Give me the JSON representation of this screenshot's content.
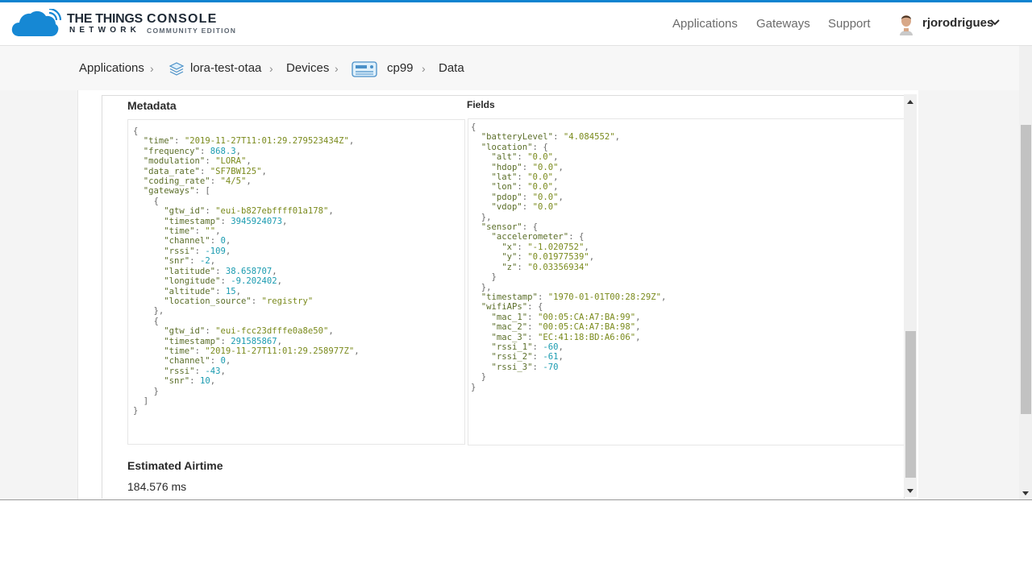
{
  "header": {
    "brand_line1": "THE THINGS",
    "brand_line2": "NETWORK",
    "console_line1": "CONSOLE",
    "console_line2": "COMMUNITY EDITION",
    "nav": [
      "Applications",
      "Gateways",
      "Support"
    ],
    "username": "rjorodrigues",
    "brand_color": "#1688d4"
  },
  "breadcrumb": {
    "items": [
      "Applications",
      "lora-test-otaa",
      "Devices",
      "cp99",
      "Data"
    ]
  },
  "metadata": {
    "title": "Metadata",
    "json": "{\n  \"time\": \"2019-11-27T11:01:29.279523434Z\",\n  \"frequency\": 868.3,\n  \"modulation\": \"LORA\",\n  \"data_rate\": \"SF7BW125\",\n  \"coding_rate\": \"4/5\",\n  \"gateways\": [\n    {\n      \"gtw_id\": \"eui-b827ebffff01a178\",\n      \"timestamp\": 3945924073,\n      \"time\": \"\",\n      \"channel\": 0,\n      \"rssi\": -109,\n      \"snr\": -2,\n      \"latitude\": 38.658707,\n      \"longitude\": -9.202402,\n      \"altitude\": 15,\n      \"location_source\": \"registry\"\n    },\n    {\n      \"gtw_id\": \"eui-fcc23dfffe0a8e50\",\n      \"timestamp\": 291585867,\n      \"time\": \"2019-11-27T11:01:29.258977Z\",\n      \"channel\": 0,\n      \"rssi\": -43,\n      \"snr\": 10,\n    }\n  ]\n}"
  },
  "fields": {
    "title": "Fields",
    "json": "{\n  \"batteryLevel\": \"4.084552\",\n  \"location\": {\n    \"alt\": \"0.0\",\n    \"hdop\": \"0.0\",\n    \"lat\": \"0.0\",\n    \"lon\": \"0.0\",\n    \"pdop\": \"0.0\",\n    \"vdop\": \"0.0\"\n  },\n  \"sensor\": {\n    \"accelerometer\": {\n      \"x\": \"-1.020752\",\n      \"y\": \"0.01977539\",\n      \"z\": \"0.03356934\"\n    }\n  },\n  \"timestamp\": \"1970-01-01T00:28:29Z\",\n  \"wifiAPs\": {\n    \"mac_1\": \"00:05:CA:A7:BA:99\",\n    \"mac_2\": \"00:05:CA:A7:BA:98\",\n    \"mac_3\": \"EC:41:18:BD:A6:06\",\n    \"rssi_1\": -60,\n    \"rssi_2\": -61,\n    \"rssi_3\": -70\n  }\n}"
  },
  "airtime": {
    "title": "Estimated Airtime",
    "value": "184.576 ms"
  }
}
